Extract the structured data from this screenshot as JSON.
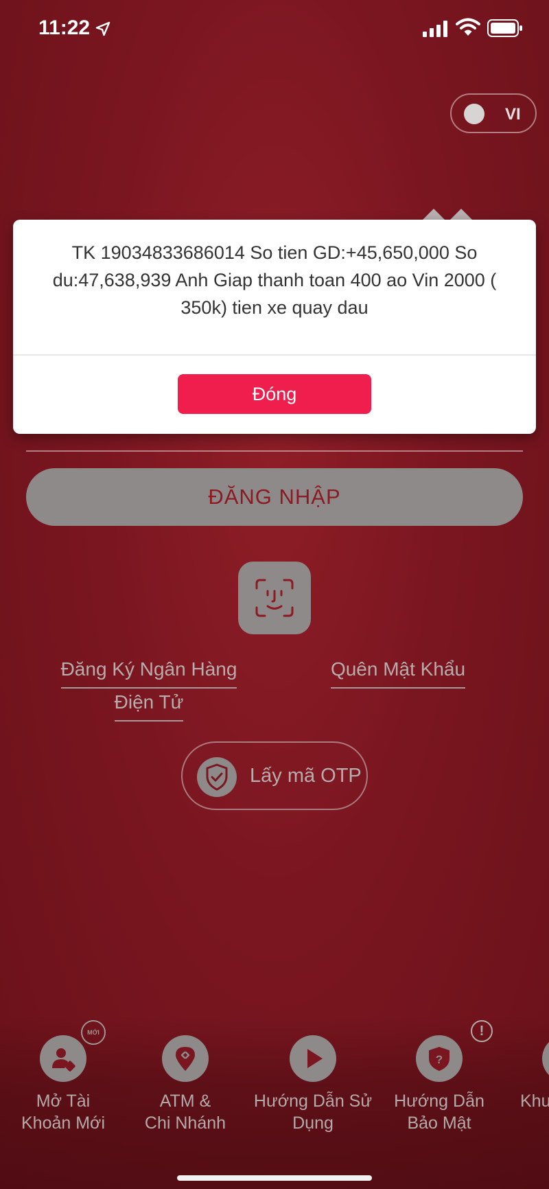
{
  "status_bar": {
    "time": "11:22",
    "icons": [
      "location-arrow-icon",
      "cellular-signal-icon",
      "wifi-icon",
      "battery-icon"
    ]
  },
  "language_toggle": {
    "label": "VI"
  },
  "dialog": {
    "message": "TK 19034833686014 So tien GD:+45,650,000 So du:47,638,939 Anh Giap thanh toan 400 ao Vin 2000 ( 350k) tien xe quay dau",
    "close_label": "Đóng"
  },
  "login": {
    "button_label": "ĐĂNG NHẬP",
    "faceid_icon": "face-id-icon",
    "register_line1": "Đăng Ký Ngân Hàng",
    "register_line2": "Điện Tử",
    "forgot_password": "Quên Mật Khẩu",
    "otp_label": "Lấy mã OTP",
    "otp_icon": "shield-check-icon"
  },
  "bottom_nav": {
    "items": [
      {
        "line1": "Mở Tài",
        "line2": "Khoản Mới",
        "icon": "user-add-icon",
        "badge": "MỚI"
      },
      {
        "line1": "ATM &",
        "line2": "Chi Nhánh",
        "icon": "map-pin-icon"
      },
      {
        "line1": "Hướng Dẫn Sử",
        "line2": "Dụng",
        "icon": "play-icon"
      },
      {
        "line1": "Hướng Dẫn",
        "line2": "Bảo Mật",
        "icon": "shield-question-icon",
        "badge": "!"
      },
      {
        "line1": "Khu",
        "line2": "",
        "icon": "partial-icon"
      }
    ]
  },
  "colors": {
    "background": "#7a1620",
    "dialog_button": "#f01e4c",
    "login_button": "#8e8a8a",
    "login_text": "#8b1a22"
  }
}
